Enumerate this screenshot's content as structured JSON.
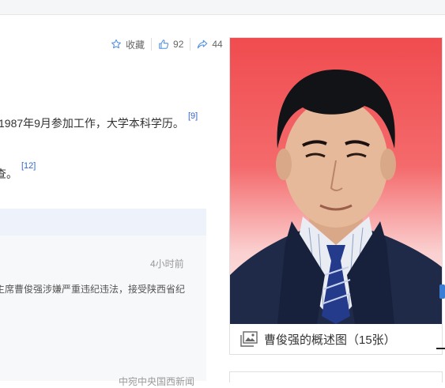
{
  "actions": {
    "favorite_label": "收藏",
    "like_count": "92",
    "share_count": "44"
  },
  "content": {
    "line1": "1987年9月参加工作，大学本科学历。",
    "line1_ref": "[9]",
    "line2": "查。",
    "line2_ref": "[12]"
  },
  "news": {
    "time": "4小时前",
    "text": "主席曹俊强涉嫌严重违纪违法，接受陕西省纪",
    "text_cont": "。",
    "source": "中宛中央国西新闻"
  },
  "photo": {
    "caption": "曹俊强的概述图（15张）"
  },
  "colors": {
    "link": "#3366cc",
    "accent_icon": "#4e8fe0",
    "photo_bg": "#f04c4f"
  }
}
